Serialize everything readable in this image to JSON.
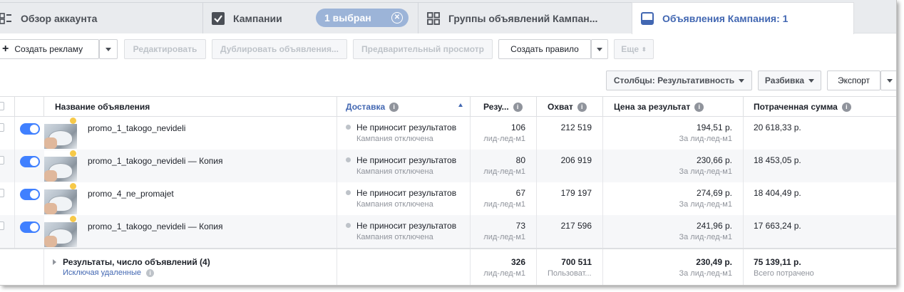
{
  "tabs": [
    {
      "label": "Обзор аккаунта"
    },
    {
      "label": "Кампании",
      "badge": "1 выбран"
    },
    {
      "label": "Группы объявлений Кампан..."
    },
    {
      "label": "Объявления Кампания: 1"
    }
  ],
  "toolbar": {
    "create_ad": "Создать рекламу",
    "edit": "Редактировать",
    "duplicate": "Дублировать объявления...",
    "preview": "Предварительный просмотр",
    "create_rule": "Создать правило",
    "more": "Еще"
  },
  "toolbar2": {
    "columns": "Столбцы: Результативность",
    "breakdown": "Разбивка",
    "export": "Экспорт"
  },
  "columns": {
    "name": "Название объявления",
    "delivery": "Доставка",
    "results": "Резу...",
    "reach": "Охват",
    "cost": "Цена за результат",
    "spent": "Потраченная сумма"
  },
  "rows": [
    {
      "name": "promo_1_takogo_nevideli",
      "delivery": "Не приносит результатов",
      "delivery_sub": "Кампания отключена",
      "results": "106",
      "results_sub": "лид-лед-м1",
      "reach": "212 519",
      "cost": "194,51 р.",
      "cost_sub": "За лид-лед-м1",
      "spent": "20 618,33 р."
    },
    {
      "name": "promo_1_takogo_nevideli — Копия",
      "delivery": "Не приносит результатов",
      "delivery_sub": "Кампания отключена",
      "results": "80",
      "results_sub": "лид-лед-м1",
      "reach": "206 919",
      "cost": "230,66 р.",
      "cost_sub": "За лид-лед-м1",
      "spent": "18 453,05 р."
    },
    {
      "name": "promo_4_ne_promajet",
      "delivery": "Не приносит результатов",
      "delivery_sub": "Кампания отключена",
      "results": "67",
      "results_sub": "лид-лед-м1",
      "reach": "179 197",
      "cost": "274,69 р.",
      "cost_sub": "За лид-лед-м1",
      "spent": "18 404,49 р."
    },
    {
      "name": "promo_1_takogo_nevideli — Копия",
      "delivery": "Не приносит результатов",
      "delivery_sub": "Кампания отключена",
      "results": "73",
      "results_sub": "лид-лед-м1",
      "reach": "217 596",
      "cost": "241,96 р.",
      "cost_sub": "За лид-лед-м1",
      "spent": "17 663,24 р."
    }
  ],
  "totals": {
    "label": "Результаты, число объявлений (4)",
    "excluding": "Исключая удаленные",
    "results": "326",
    "results_sub": "лид-лед-м1",
    "reach": "700 511",
    "reach_sub": "Пользоват...",
    "cost": "230,49 р.",
    "cost_sub": "За лид-лед-м1",
    "spent": "75 139,11 р.",
    "spent_sub": "Всего потрачено"
  },
  "colors": {
    "accent": "#4267b2",
    "toggle": "#4080ff"
  }
}
